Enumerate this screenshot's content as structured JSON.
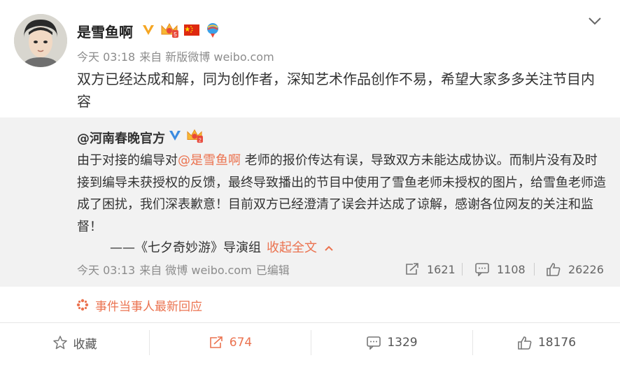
{
  "post": {
    "username": "是雪鱼啊",
    "time": "今天 03:18",
    "via": "来自 新版微博 weibo.com",
    "text": "双方已经达成和解，同为创作者，深知艺术作品创作不易，希望大家多多关注节目内容"
  },
  "repost": {
    "username": "@河南春晚官方",
    "text_before": "由于对接的编导对",
    "mention": "@是雪鱼啊",
    "text_after": " 老师的报价传达有误，导致双方未能达成协议。而制片没有及时接到编导未获授权的反馈，最终导致播出的节目中使用了雪鱼老师未授权的图片，给雪鱼老师造成了困扰，我们深表歉意！目前双方已经澄清了误会并达成了谅解，感谢各位网友的关注和监督！",
    "signature": "——《七夕奇妙游》导演组",
    "collapse_label": "收起全文",
    "time": "今天 03:13",
    "via": "来自 微博 weibo.com",
    "edited": "已编辑",
    "reposts": "1621",
    "comments": "1108",
    "likes": "26226"
  },
  "event": {
    "label": "事件当事人最新回应"
  },
  "actions": {
    "favorite": "收藏",
    "repost": "674",
    "comment": "1329",
    "like": "18176"
  },
  "colors": {
    "accent": "#eb7350",
    "verified": "#f5a623",
    "repost_bg": "#f2f2f2"
  },
  "icons": [
    "verified-icon",
    "vip-crown-icon",
    "china-flag-icon",
    "pride-badge-icon",
    "chevron-down-icon",
    "repost-icon",
    "comment-icon",
    "like-icon",
    "star-icon",
    "event-icon"
  ]
}
